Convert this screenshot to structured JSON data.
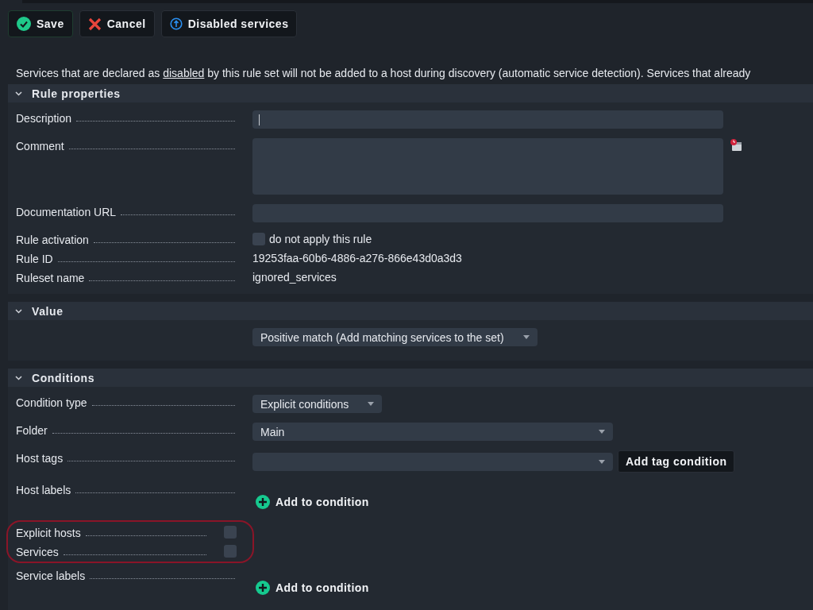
{
  "toolbar": [
    {
      "kind": "save",
      "label": "Save"
    },
    {
      "kind": "cancel",
      "label": "Cancel"
    },
    {
      "kind": "info",
      "label": "Disabled services"
    }
  ],
  "intro": {
    "before": "Services that are declared as",
    "link": "disabled",
    "after": "by this rule set will not be added to a host during discovery (automatic service detection). Services that already"
  },
  "sections": [
    {
      "title": "Rule properties",
      "expanded": true,
      "rows": [
        {
          "label": "Description",
          "kind": "input",
          "focused": true
        },
        {
          "label": "Comment",
          "kind": "textarea"
        },
        {
          "label": "Documentation URL",
          "kind": "input"
        },
        {
          "label": "Rule activation",
          "kind": "checkbox",
          "checked": false,
          "text": "do not apply this rule"
        },
        {
          "label": "Rule ID",
          "kind": "text",
          "value": "19253faa-60b6-4886-a276-866e43d0a3d3"
        },
        {
          "label": "Ruleset name",
          "kind": "text",
          "value": "ignored_services"
        }
      ]
    },
    {
      "title": "Value",
      "expanded": true,
      "rows": [
        {
          "kind": "select",
          "value": "Positive match (Add matching services to the set)"
        }
      ]
    },
    {
      "title": "Conditions",
      "expanded": true,
      "rows": [
        {
          "label": "Condition type",
          "kind": "select",
          "value": "Explicit conditions"
        },
        {
          "label": "Folder",
          "kind": "wide_select",
          "value": "Main"
        },
        {
          "label": "Host tags",
          "kind": "wide_select",
          "button": "Add tag condition"
        },
        {
          "label": "Host labels",
          "kind": "add",
          "button": "Add to condition"
        },
        {
          "label": "Explicit hosts",
          "kind": "check",
          "checked": false,
          "highlighted": true
        },
        {
          "label": "Services",
          "kind": "check",
          "checked": false,
          "highlighted": true
        },
        {
          "label": "Service labels",
          "kind": "add",
          "button": "Add to condition"
        }
      ]
    }
  ]
}
